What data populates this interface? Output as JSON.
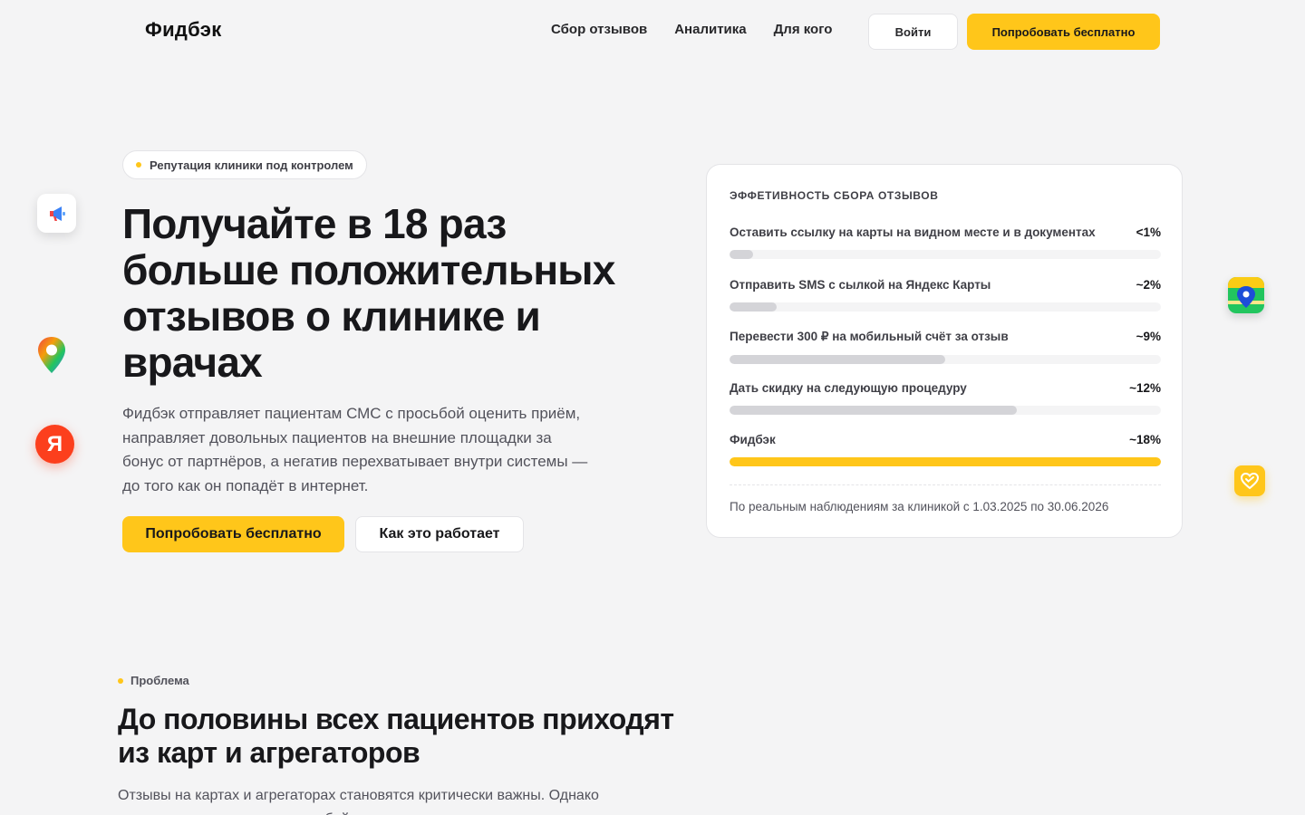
{
  "header": {
    "logo": "Фидбэк",
    "nav": [
      "Сбор отзывов",
      "Аналитика",
      "Для кого"
    ],
    "login_label": "Войти",
    "try_label": "Попробовать бесплатно"
  },
  "floating_icons": [
    "megaphone-icon",
    "map-pin-icon",
    "yandex-icon",
    "2gis-icon",
    "heart-icon"
  ],
  "hero": {
    "badge": "Репутация клиники под контролем",
    "title": "Получайте в 18 раз больше положительных отзывов о клинике и врачах",
    "text": "Фидбэк отправляет пациентам СМС с просьбой оценить приём, направляет довольных пациентов на внешние площадки за бонус от партнёров, а негатив перехватывает внутри системы — до того как он попадёт в интернет.",
    "try_label": "Попробовать бесплатно",
    "how_label": "Как это работает"
  },
  "card": {
    "title": "ЭФФЕТИВНОСТЬ СБОРА ОТЗЫВОВ",
    "rows": [
      {
        "label": "Оставить ссылку на карты на видном месте и в документах",
        "value": "<1%",
        "fraction": 0.055,
        "accent": false
      },
      {
        "label": "Отправить SMS с сылкой на Яндекс Карты",
        "value": "~2%",
        "fraction": 0.11,
        "accent": false
      },
      {
        "label": "Перевести 300 ₽ на мобильный счёт за отзыв",
        "value": "~9%",
        "fraction": 0.5,
        "accent": false
      },
      {
        "label": "Дать скидку на следующую процедуру",
        "value": "~12%",
        "fraction": 0.667,
        "accent": false
      },
      {
        "label": "Фидбэк",
        "value": "~18%",
        "fraction": 1.0,
        "accent": true
      }
    ],
    "footnote": "По реальным наблюдениям за клиникой с 1.03.2025 по 30.06.2026"
  },
  "problem": {
    "label": "Проблема",
    "title": "До половины всех пациентов приходят из карт и агрегаторов",
    "text": "Отзывы на картах и агрегаторах становятся критически важны. Однако стандартная рассылка с просьбой их оставить может разочаровать клинику."
  },
  "colors": {
    "accent": "#ffc61a",
    "background": "#f4f4f5",
    "bar_neutral": "#d4d4d8"
  }
}
